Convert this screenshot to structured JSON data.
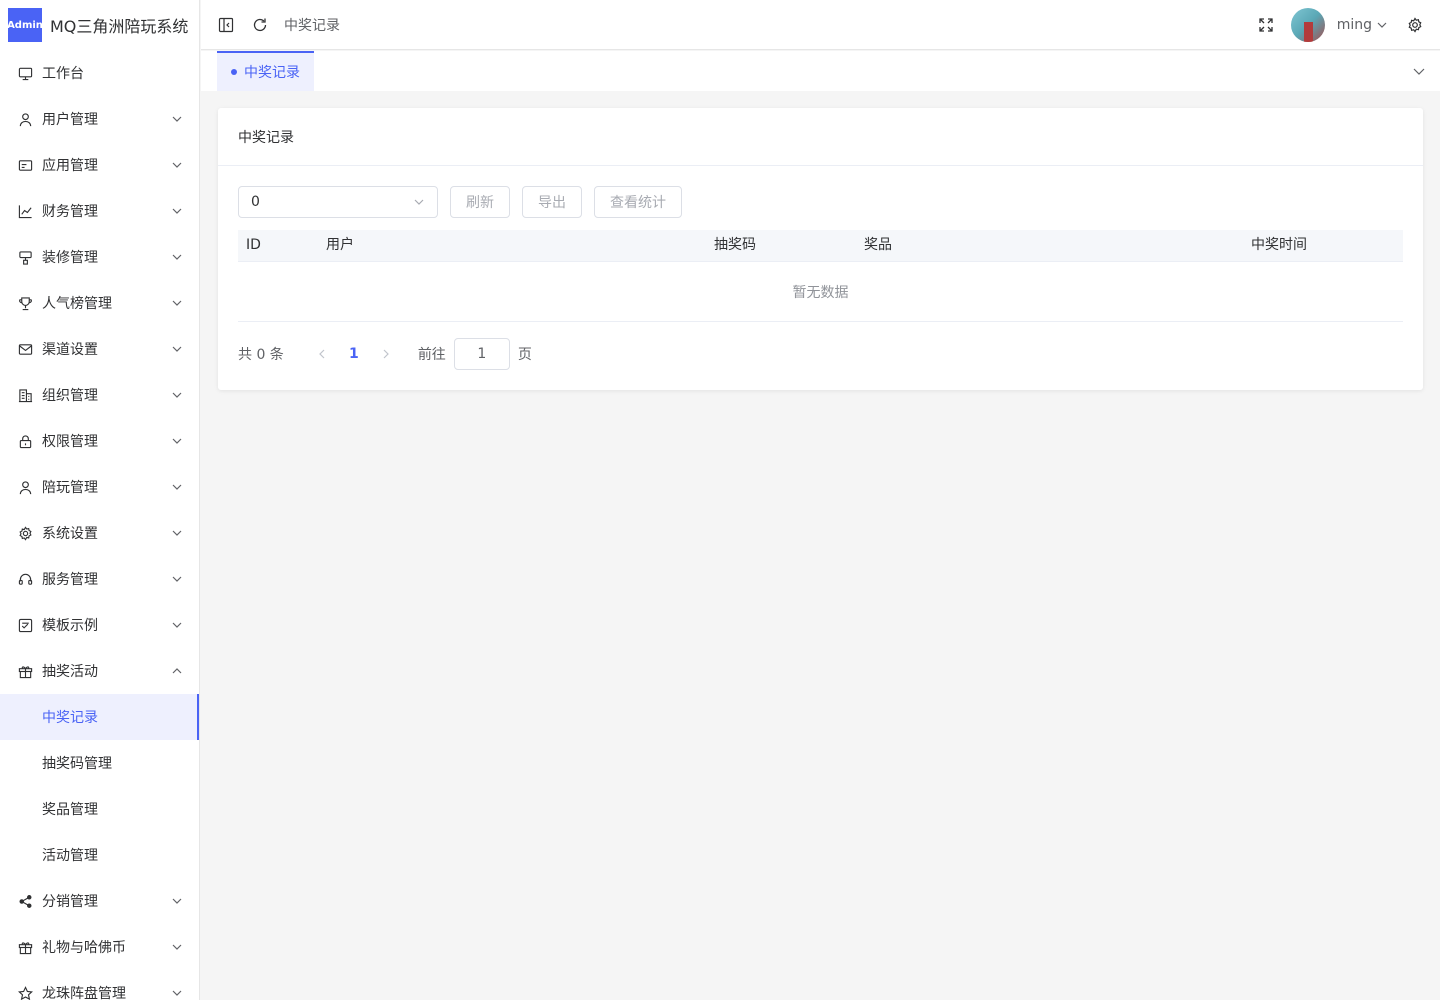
{
  "app": {
    "badge": "Admin",
    "title": "MQ三角洲陪玩系统"
  },
  "sidebar": {
    "items": [
      {
        "label": "工作台",
        "icon": "monitor-icon",
        "expandable": false
      },
      {
        "label": "用户管理",
        "icon": "user-icon",
        "expandable": true
      },
      {
        "label": "应用管理",
        "icon": "app-icon",
        "expandable": true
      },
      {
        "label": "财务管理",
        "icon": "chart-icon",
        "expandable": true
      },
      {
        "label": "装修管理",
        "icon": "decor-icon",
        "expandable": true
      },
      {
        "label": "人气榜管理",
        "icon": "trophy-icon",
        "expandable": true
      },
      {
        "label": "渠道设置",
        "icon": "mail-icon",
        "expandable": true
      },
      {
        "label": "组织管理",
        "icon": "building-icon",
        "expandable": true
      },
      {
        "label": "权限管理",
        "icon": "lock-icon",
        "expandable": true
      },
      {
        "label": "陪玩管理",
        "icon": "user-icon",
        "expandable": true
      },
      {
        "label": "系统设置",
        "icon": "gear-icon",
        "expandable": true
      },
      {
        "label": "服务管理",
        "icon": "headset-icon",
        "expandable": true
      },
      {
        "label": "模板示例",
        "icon": "template-icon",
        "expandable": true
      },
      {
        "label": "抽奖活动",
        "icon": "gift-icon",
        "expandable": true,
        "expanded": true
      }
    ],
    "lottery_children": [
      {
        "label": "中奖记录",
        "active": true
      },
      {
        "label": "抽奖码管理"
      },
      {
        "label": "奖品管理"
      },
      {
        "label": "活动管理"
      }
    ],
    "items_after": [
      {
        "label": "分销管理",
        "icon": "share-icon"
      },
      {
        "label": "礼物与哈佛币",
        "icon": "gift-icon"
      },
      {
        "label": "龙珠阵盘管理",
        "icon": "star-icon"
      }
    ]
  },
  "header": {
    "breadcrumb": "中奖记录",
    "username": "ming"
  },
  "tags": {
    "active_tag": "中奖记录"
  },
  "card": {
    "title": "中奖记录",
    "select_value": "0",
    "buttons": {
      "refresh": "刷新",
      "export": "导出",
      "stats": "查看统计"
    },
    "columns": [
      "ID",
      "用户",
      "抽奖码",
      "奖品",
      "中奖时间"
    ],
    "empty_text": "暂无数据"
  },
  "pager": {
    "total_text": "共 0 条",
    "current_page": "1",
    "goto_label": "前往",
    "goto_value": "1",
    "page_suffix": "页"
  },
  "colors": {
    "accent": "#4a63f5",
    "active_bg": "#eef0fe"
  }
}
